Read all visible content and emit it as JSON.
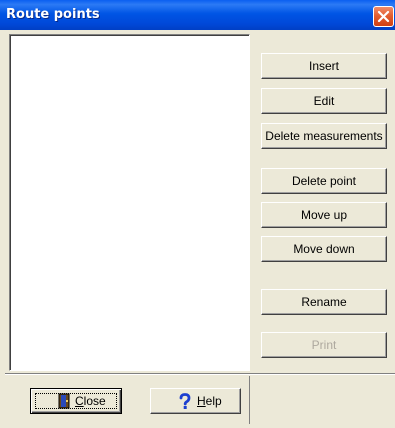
{
  "window": {
    "title": "Route points"
  },
  "icons": {
    "close": "close-icon",
    "door": "door-icon",
    "help": "question-mark-icon"
  },
  "colors": {
    "titlebar": "#0055e5",
    "close_button": "#e35f32",
    "dialog_bg": "#ece9d8",
    "disabled_text": "#ada89e",
    "help_icon": "#1c3fd0"
  },
  "route_points_list": {
    "items": []
  },
  "buttons": {
    "insert": "Insert",
    "edit": "Edit",
    "delete_measurements": "Delete measurements",
    "delete_point": "Delete point",
    "move_up": "Move up",
    "move_down": "Move down",
    "rename": "Rename",
    "print": "Print"
  },
  "bottom": {
    "close_mnemonic": "C",
    "close_rest": "lose",
    "help_mnemonic": "H",
    "help_rest": "elp"
  }
}
